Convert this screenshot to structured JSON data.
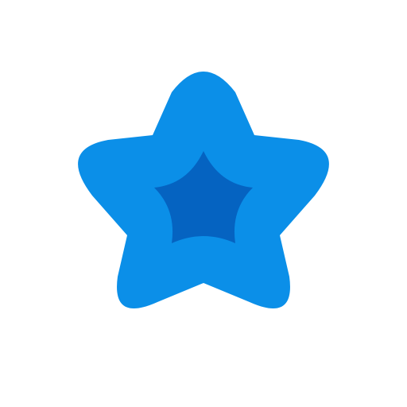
{
  "icon": {
    "name": "star-icon",
    "outer_color": "#0B8FE8",
    "inner_color": "#0563C1",
    "background": "#FFFFFF"
  }
}
